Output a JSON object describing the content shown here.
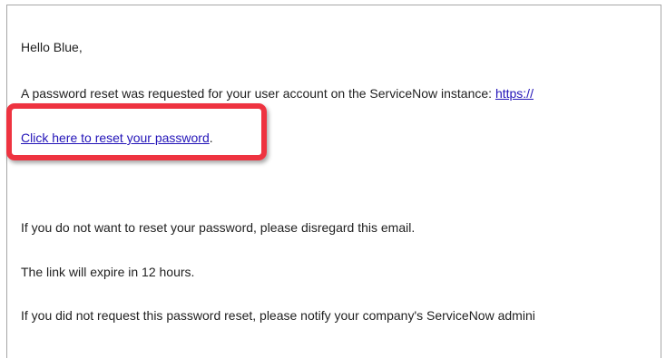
{
  "email": {
    "greeting": "Hello Blue,",
    "request_text": "A password reset was requested for your user account on the ServiceNow instance: ",
    "instance_link": "https://",
    "reset_link": "Click here to reset your password",
    "reset_suffix": ".",
    "disregard_text": "If you do not want to reset your password, please disregard this email.",
    "expire_text": "The link will expire in 12 hours.",
    "notify_text": "If you did not request this password reset, please notify your company's ServiceNow admini"
  },
  "annotation": {
    "highlight_color": "#ee3340"
  }
}
